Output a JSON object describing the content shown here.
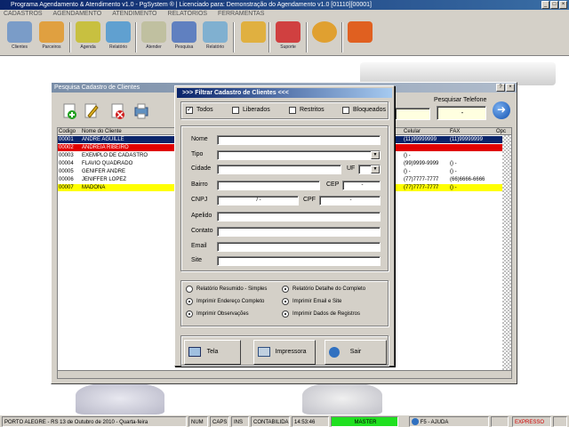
{
  "app": {
    "title": "Programa Agendamento & Atendimento v1.0 - PgSystem ® | Licenciado para: Demonstração do Agendamento v1.0 [01110][00001]",
    "menu": [
      "CADASTROS",
      "AGENDAMENTO",
      "ATENDIMENTO",
      "RELATÓRIOS",
      "FERRAMENTAS"
    ],
    "toolbar": [
      {
        "label": "Clientes",
        "icon": "clients-icon",
        "color": "#7a9cc8"
      },
      {
        "label": "Parceiros",
        "icon": "partners-icon",
        "color": "#e0a040"
      },
      {
        "label": "Agenda",
        "icon": "schedule-icon",
        "color": "#c8c040"
      },
      {
        "label": "Relatório",
        "icon": "report-icon",
        "color": "#60a0d0"
      },
      {
        "label": "Atender",
        "icon": "attend-icon",
        "color": "#c0c0a0"
      },
      {
        "label": "Pesquisa",
        "icon": "search-icon",
        "color": "#6080c0"
      },
      {
        "label": "Relatório",
        "icon": "report2-icon",
        "color": "#80b0d0"
      },
      {
        "label": "",
        "icon": "calculator-icon",
        "color": "#e0b040"
      },
      {
        "label": "Suporte",
        "icon": "support-icon",
        "color": "#d04040"
      },
      {
        "label": "",
        "icon": "tools-icon",
        "color": "#e0a030"
      },
      {
        "label": "",
        "icon": "exit-door-icon",
        "color": "#e06020"
      }
    ]
  },
  "clients_window": {
    "title": "Pesquisa Cadastro de Clientes",
    "search_label": "Pesquisar Telefone",
    "search_value": "-",
    "columns": [
      "Codigo",
      "Nome do Cliente",
      "Celular",
      "FAX",
      "Opc"
    ],
    "rows": [
      {
        "code": "00001",
        "name": "ANDRE AGUILLE",
        "cel": "(11)99999999",
        "fax": "(11)99999999",
        "style": "sel"
      },
      {
        "code": "00002",
        "name": "ANDREIA RIBEIRO",
        "cel": "",
        "fax": "",
        "style": "red"
      },
      {
        "code": "00003",
        "name": "EXEMPLO DE CADASTRO",
        "cel": "() -",
        "fax": "",
        "style": "normal"
      },
      {
        "code": "00004",
        "name": "FLAVIO QUADRADO",
        "cel": "(99)9999-9999",
        "fax": "() -",
        "style": "normal"
      },
      {
        "code": "00005",
        "name": "GENIFER ANDRE",
        "cel": "() -",
        "fax": "() -",
        "style": "normal"
      },
      {
        "code": "00006",
        "name": "JENIFFER LOPEZ",
        "cel": "(77)7777-7777",
        "fax": "(66)6666-6666",
        "style": "normal"
      },
      {
        "code": "00007",
        "name": "MADONA",
        "cel": "(77)7777-7777",
        "fax": "() -",
        "style": "yellow"
      }
    ]
  },
  "filter_dialog": {
    "title": ">>> Filtrar Cadastro de Clientes <<<",
    "filters": [
      {
        "label": "Todos",
        "checked": true
      },
      {
        "label": "Liberados",
        "checked": false
      },
      {
        "label": "Restritos",
        "checked": false
      },
      {
        "label": "Bloqueados",
        "checked": false
      }
    ],
    "fields": {
      "nome": "Nome",
      "tipo": "Tipo",
      "cidade": "Cidade",
      "uf": "UF",
      "bairro": "Bairro",
      "cep": "CEP",
      "cep_value": "-",
      "cnpj": "CNPJ",
      "cnpj_value": "/ -",
      "cpf": "CPF",
      "cpf_value": "-",
      "apelido": "Apelido",
      "contato": "Contato",
      "email": "Email",
      "site": "Site"
    },
    "options": [
      {
        "label": "Relatório Resumido - Simples",
        "on": false
      },
      {
        "label": "Relatório Detalhe do Completo",
        "on": true
      },
      {
        "label": "Imprimir Endereço Completo",
        "on": true
      },
      {
        "label": "Imprimir Email e Site",
        "on": true
      },
      {
        "label": "Imprimir Observações",
        "on": true
      },
      {
        "label": "Imprimir Dados de Registros",
        "on": true
      }
    ],
    "buttons": {
      "tela": "Tela",
      "impressora": "Impressora",
      "sair": "Sair"
    }
  },
  "status": {
    "location": "PORTO ALEGRE - RS 13 de Outubro de 2010 - Quarta-feira",
    "num": "NUM",
    "caps": "CAPS",
    "ins": "INS",
    "insert": "CONTABILIDADE",
    "time": "14:53:46",
    "user": "MASTER",
    "help": "F5 - AJUDA",
    "flag": "EXPRESSO"
  }
}
